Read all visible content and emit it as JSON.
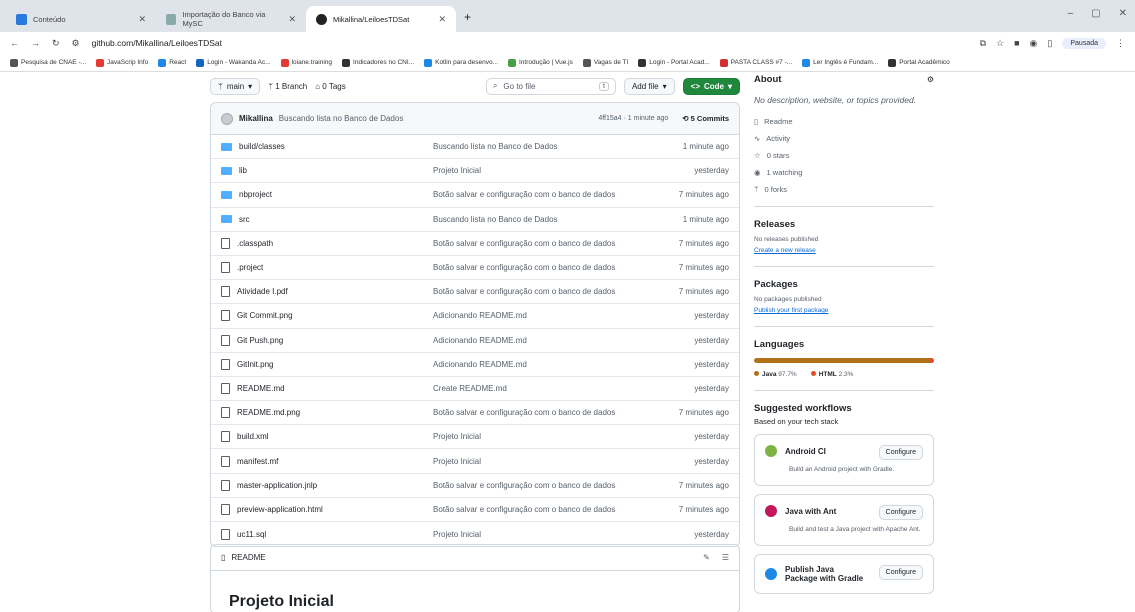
{
  "browser": {
    "tabs": [
      {
        "label": "Conteúdo",
        "color": "#2a7ade"
      },
      {
        "label": "Importação do Banco via MySC",
        "color": "#8aa"
      },
      {
        "label": "Mikallina/LeiloesTDSat",
        "color": "#222"
      }
    ],
    "url": "github.com/Mikallina/LeiloesTDSat",
    "paused_label": "Pausada",
    "bookmarks": [
      "Pesquisa de CNAE -...",
      "JavaScrip Info",
      "React",
      "Login - Wakanda Ac...",
      "loiane.training",
      "Indicadores no CNI...",
      "Kotlin para desenvo...",
      "Introdução | Vue.js",
      "Vagas de TI",
      "Login - Portal Acad...",
      "PASTA CLASS #7 -...",
      "Ler Inglês é Fundam...",
      "Portal Acadêmico"
    ]
  },
  "repo": {
    "branch": "main",
    "branches": "1 Branch",
    "tags": "0 Tags",
    "go_to_file": "Go to file",
    "go_to_file_key": "t",
    "add_file": "Add file",
    "code": "Code",
    "commit": {
      "author": "Mikallina",
      "message": "Buscando lista no Banco de Dados",
      "meta": "4ff15a4 · 1 minute ago",
      "commits": "5 Commits"
    },
    "files": [
      {
        "name": "build/classes",
        "folder": true,
        "msg": "Buscando lista no Banco de Dados",
        "age": "1 minute ago"
      },
      {
        "name": "lib",
        "folder": true,
        "msg": "Projeto Inicial",
        "age": "yesterday"
      },
      {
        "name": "nbproject",
        "folder": true,
        "msg": "Botão salvar e configuração com o banco de dados",
        "age": "7 minutes ago"
      },
      {
        "name": "src",
        "folder": true,
        "msg": "Buscando lista no Banco de Dados",
        "age": "1 minute ago"
      },
      {
        "name": ".classpath",
        "folder": false,
        "msg": "Botão salvar e configuração com o banco de dados",
        "age": "7 minutes ago"
      },
      {
        "name": ".project",
        "folder": false,
        "msg": "Botão salvar e configuração com o banco de dados",
        "age": "7 minutes ago"
      },
      {
        "name": "Atividade I.pdf",
        "folder": false,
        "msg": "Botão salvar e configuração com o banco de dados",
        "age": "7 minutes ago"
      },
      {
        "name": "Git Commit.png",
        "folder": false,
        "msg": "Adicionando README.md",
        "age": "yesterday"
      },
      {
        "name": "Git Push.png",
        "folder": false,
        "msg": "Adicionando README.md",
        "age": "yesterday"
      },
      {
        "name": "GitInit.png",
        "folder": false,
        "msg": "Adicionando README.md",
        "age": "yesterday"
      },
      {
        "name": "README.md",
        "folder": false,
        "msg": "Create README.md",
        "age": "yesterday"
      },
      {
        "name": "README.md.png",
        "folder": false,
        "msg": "Botão salvar e configuração com o banco de dados",
        "age": "7 minutes ago"
      },
      {
        "name": "build.xml",
        "folder": false,
        "msg": "Projeto Inicial",
        "age": "yesterday"
      },
      {
        "name": "manifest.mf",
        "folder": false,
        "msg": "Projeto Inicial",
        "age": "yesterday"
      },
      {
        "name": "master-application.jnlp",
        "folder": false,
        "msg": "Botão salvar e configuração com o banco de dados",
        "age": "7 minutes ago"
      },
      {
        "name": "preview-application.html",
        "folder": false,
        "msg": "Botão salvar e configuração com o banco de dados",
        "age": "7 minutes ago"
      },
      {
        "name": "uc11.sql",
        "folder": false,
        "msg": "Projeto Inicial",
        "age": "yesterday"
      }
    ],
    "readme_label": "README",
    "readme_title": "Projeto Inicial"
  },
  "about": {
    "title": "About",
    "description": "No description, website, or topics provided.",
    "readme": "Readme",
    "activity": "Activity",
    "stars": "0 stars",
    "watching": "1 watching",
    "forks": "0 forks",
    "releases_title": "Releases",
    "releases_none": "No releases published",
    "releases_link": "Create a new release",
    "packages_title": "Packages",
    "packages_none": "No packages published",
    "packages_link": "Publish your first package",
    "languages_title": "Languages",
    "languages": [
      {
        "name": "Java",
        "percent": "97.7%",
        "value": 97.7,
        "color": "#b07219"
      },
      {
        "name": "HTML",
        "percent": "2.3%",
        "value": 2.3,
        "color": "#e34c26"
      }
    ],
    "workflows_title": "Suggested workflows",
    "workflows_sub": "Based on your tech stack",
    "workflows": [
      {
        "name": "Android CI",
        "desc": "Build an Android project with Gradle.",
        "cfg": "Configure",
        "color": "#7cb342"
      },
      {
        "name": "Java with Ant",
        "desc": "Build and test a Java project with Apache Ant.",
        "cfg": "Configure",
        "color": "#c2185b"
      },
      {
        "name": "Publish Java Package with Gradle",
        "desc": "",
        "cfg": "Configure",
        "color": "#1e88e5"
      }
    ]
  }
}
